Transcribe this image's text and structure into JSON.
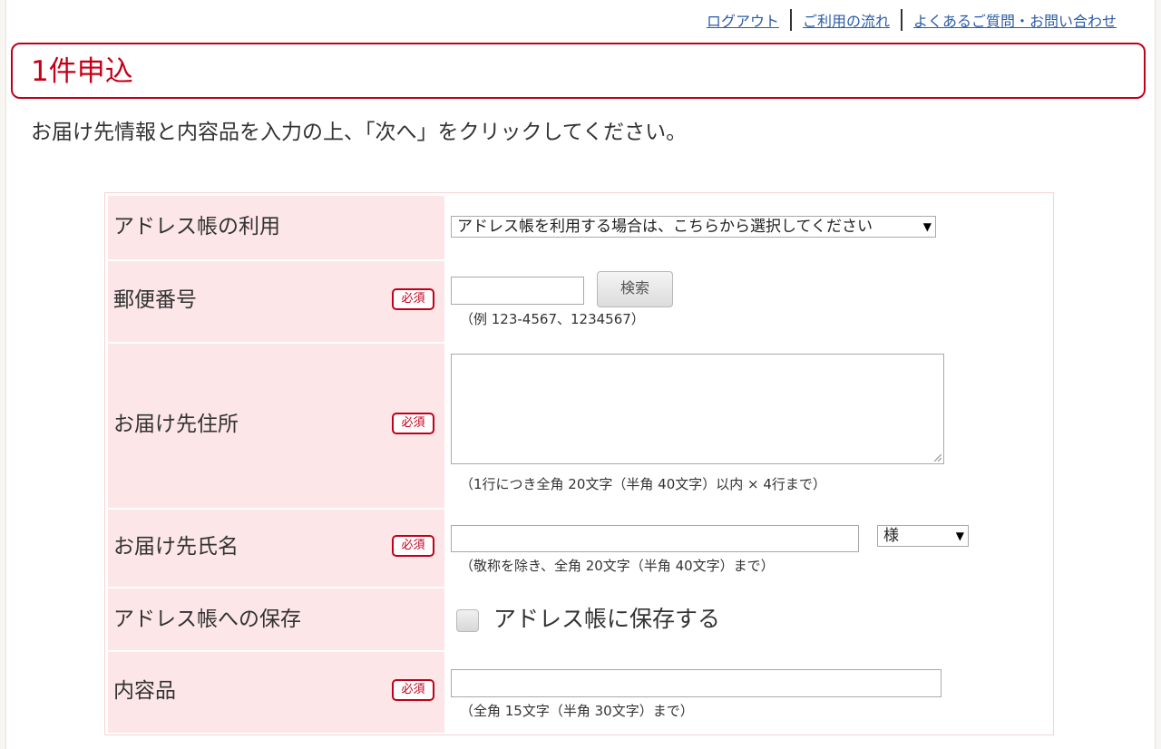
{
  "header": {
    "links": [
      {
        "label": "ログアウト"
      },
      {
        "label": "ご利用の流れ"
      },
      {
        "label": "よくあるご質問・お問い合わせ"
      }
    ]
  },
  "page_title": "1件申込",
  "instruction": "お届け先情報と内容品を入力の上、「次へ」をクリックしてください。",
  "form": {
    "required_badge": "必須",
    "address_book": {
      "label": "アドレス帳の利用",
      "select_value": "アドレス帳を利用する場合は、こちらから選択してください"
    },
    "postal_code": {
      "label": "郵便番号",
      "value": "",
      "search_button": "検索",
      "hint": "（例 123-4567、1234567）"
    },
    "address": {
      "label": "お届け先住所",
      "value": "",
      "hint": "（1行につき全角 20文字（半角 40文字）以内 × 4行まで）"
    },
    "recipient_name": {
      "label": "お届け先氏名",
      "value": "",
      "honorific": "様",
      "hint": "（敬称を除き、全角 20文字（半角 40文字）まで）"
    },
    "save_to_address_book": {
      "label": "アドレス帳への保存",
      "checkbox_label": "アドレス帳に保存する",
      "checked": false
    },
    "contents": {
      "label": "内容品",
      "value": "",
      "hint": "（全角 15文字（半角 30文字）まで）"
    }
  },
  "colors": {
    "accent_red": "#c0001a",
    "label_bg": "#fde6e7",
    "link_blue": "#2a5ca8"
  }
}
